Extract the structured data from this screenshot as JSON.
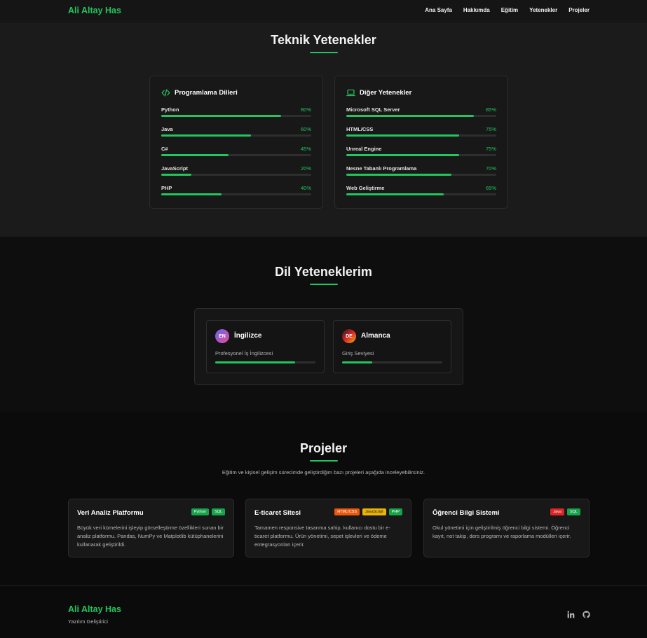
{
  "nav": {
    "brand": "Ali Altay Has",
    "links": [
      "Ana Sayfa",
      "Hakkımda",
      "Eğitim",
      "Yetenekler",
      "Projeler"
    ]
  },
  "skills": {
    "title": "Teknik Yetenekler",
    "programming": {
      "title": "Programlama Dilleri",
      "icon": "code-icon",
      "items": [
        {
          "name": "Python",
          "percent": "80%",
          "value": 80
        },
        {
          "name": "Java",
          "percent": "60%",
          "value": 60
        },
        {
          "name": "C#",
          "percent": "45%",
          "value": 45
        },
        {
          "name": "JavaScript",
          "percent": "20%",
          "value": 20
        },
        {
          "name": "PHP",
          "percent": "40%",
          "value": 40
        }
      ]
    },
    "other": {
      "title": "Diğer Yetenekler",
      "icon": "laptop-icon",
      "items": [
        {
          "name": "Microsoft SQL Server",
          "percent": "85%",
          "value": 85
        },
        {
          "name": "HTML/CSS",
          "percent": "75%",
          "value": 75
        },
        {
          "name": "Unreal Engine",
          "percent": "75%",
          "value": 75
        },
        {
          "name": "Nesne Tabanlı Programlama",
          "percent": "70%",
          "value": 70
        },
        {
          "name": "Web Geliştirme",
          "percent": "65%",
          "value": 65
        }
      ]
    }
  },
  "languages": {
    "title": "Dil Yeteneklerim",
    "items": [
      {
        "code": "EN",
        "name": "İngilizce",
        "level": "Profesyonel İş İngilizcesi",
        "value": 80
      },
      {
        "code": "DE",
        "name": "Almanca",
        "level": "Giriş Seviyesi",
        "value": 30
      }
    ]
  },
  "projects": {
    "title": "Projeler",
    "description": "Eğitim ve kişisel gelişim sürecimde geliştirdiğim bazı projeleri aşağıda inceleyebilirsiniz.",
    "items": [
      {
        "title": "Veri Analiz Platformu",
        "tags": [
          "Python",
          "SQL"
        ],
        "text": "Büyük veri kümelerini işleyip görselleştirme özellikleri sunan bir analiz platformu. Pandas, NumPy ve Matplotlib kütüphanelerini kullanarak geliştirildi."
      },
      {
        "title": "E-ticaret Sitesi",
        "tags": [
          "HTML/CSS",
          "JavaScript",
          "PHP"
        ],
        "text": "Tamamen responsive tasarıma sahip, kullanıcı dostu bir e-ticaret platformu. Ürün yönetimi, sepet işlevleri ve ödeme entegrasyonları içerir."
      },
      {
        "title": "Öğrenci Bilgi Sistemi",
        "tags": [
          "Java",
          "SQL"
        ],
        "text": "Okul yönetimi için geliştirilmiş öğrenci bilgi sistemi. Öğrenci kayıt, not takip, ders programı ve raporlama modülleri içerir."
      }
    ]
  },
  "footer": {
    "brand": "Ali Altay Has",
    "subtitle": "Yazılım Geliştirici",
    "icons": [
      "linkedin-icon",
      "github-icon"
    ]
  },
  "colors": {
    "accent": "#22c55e",
    "tag_green": "#16a34a",
    "tag_orange": "#ea580c",
    "tag_yellow": "#eab308",
    "tag_red": "#dc2626"
  }
}
